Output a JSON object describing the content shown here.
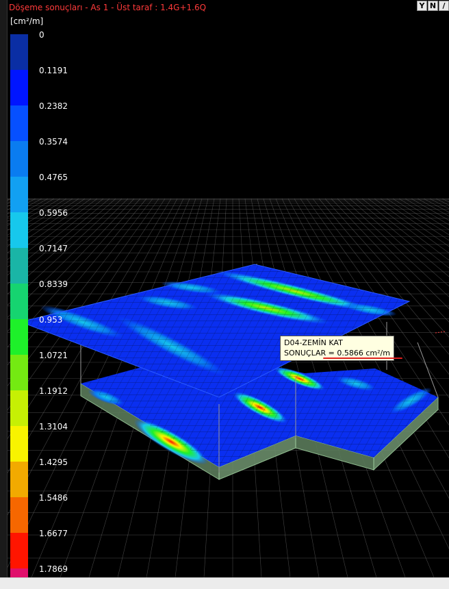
{
  "window": {
    "title": "Döşeme sonuçları - As 1 - Üst taraf : 1.4G+1.6Q",
    "toolbar": [
      {
        "name": "filter-icon",
        "label": "Y"
      },
      {
        "name": "north-icon",
        "label": "N"
      },
      {
        "name": "slash-icon",
        "label": "/"
      }
    ]
  },
  "legend": {
    "unit": "[cm²/m]",
    "labels": [
      "0",
      "0.1191",
      "0.2382",
      "0.3574",
      "0.4765",
      "0.5956",
      "0.7147",
      "0.8339",
      "0.953",
      "1.0721",
      "1.1912",
      "1.3104",
      "1.4295",
      "1.5486",
      "1.6677",
      "1.7869"
    ],
    "colors": [
      "#0a2ea4",
      "#0015ff",
      "#0650ff",
      "#0a7cf0",
      "#12a0f2",
      "#17c8ec",
      "#1ab5a6",
      "#16d470",
      "#1ef02a",
      "#74ea12",
      "#c6f004",
      "#f8f300",
      "#f2aa00",
      "#f66700",
      "#ff1500",
      "#e0106c"
    ]
  },
  "tooltip": {
    "line1": "D04-ZEMİN KAT",
    "line2": "SONUÇLAR = 0.5866 cm²/m"
  },
  "colors": {
    "title": "#ff3a3a",
    "slab_base": "#0a2ff0",
    "grid": "#7a7a7a",
    "edge": "#7fb07f"
  }
}
